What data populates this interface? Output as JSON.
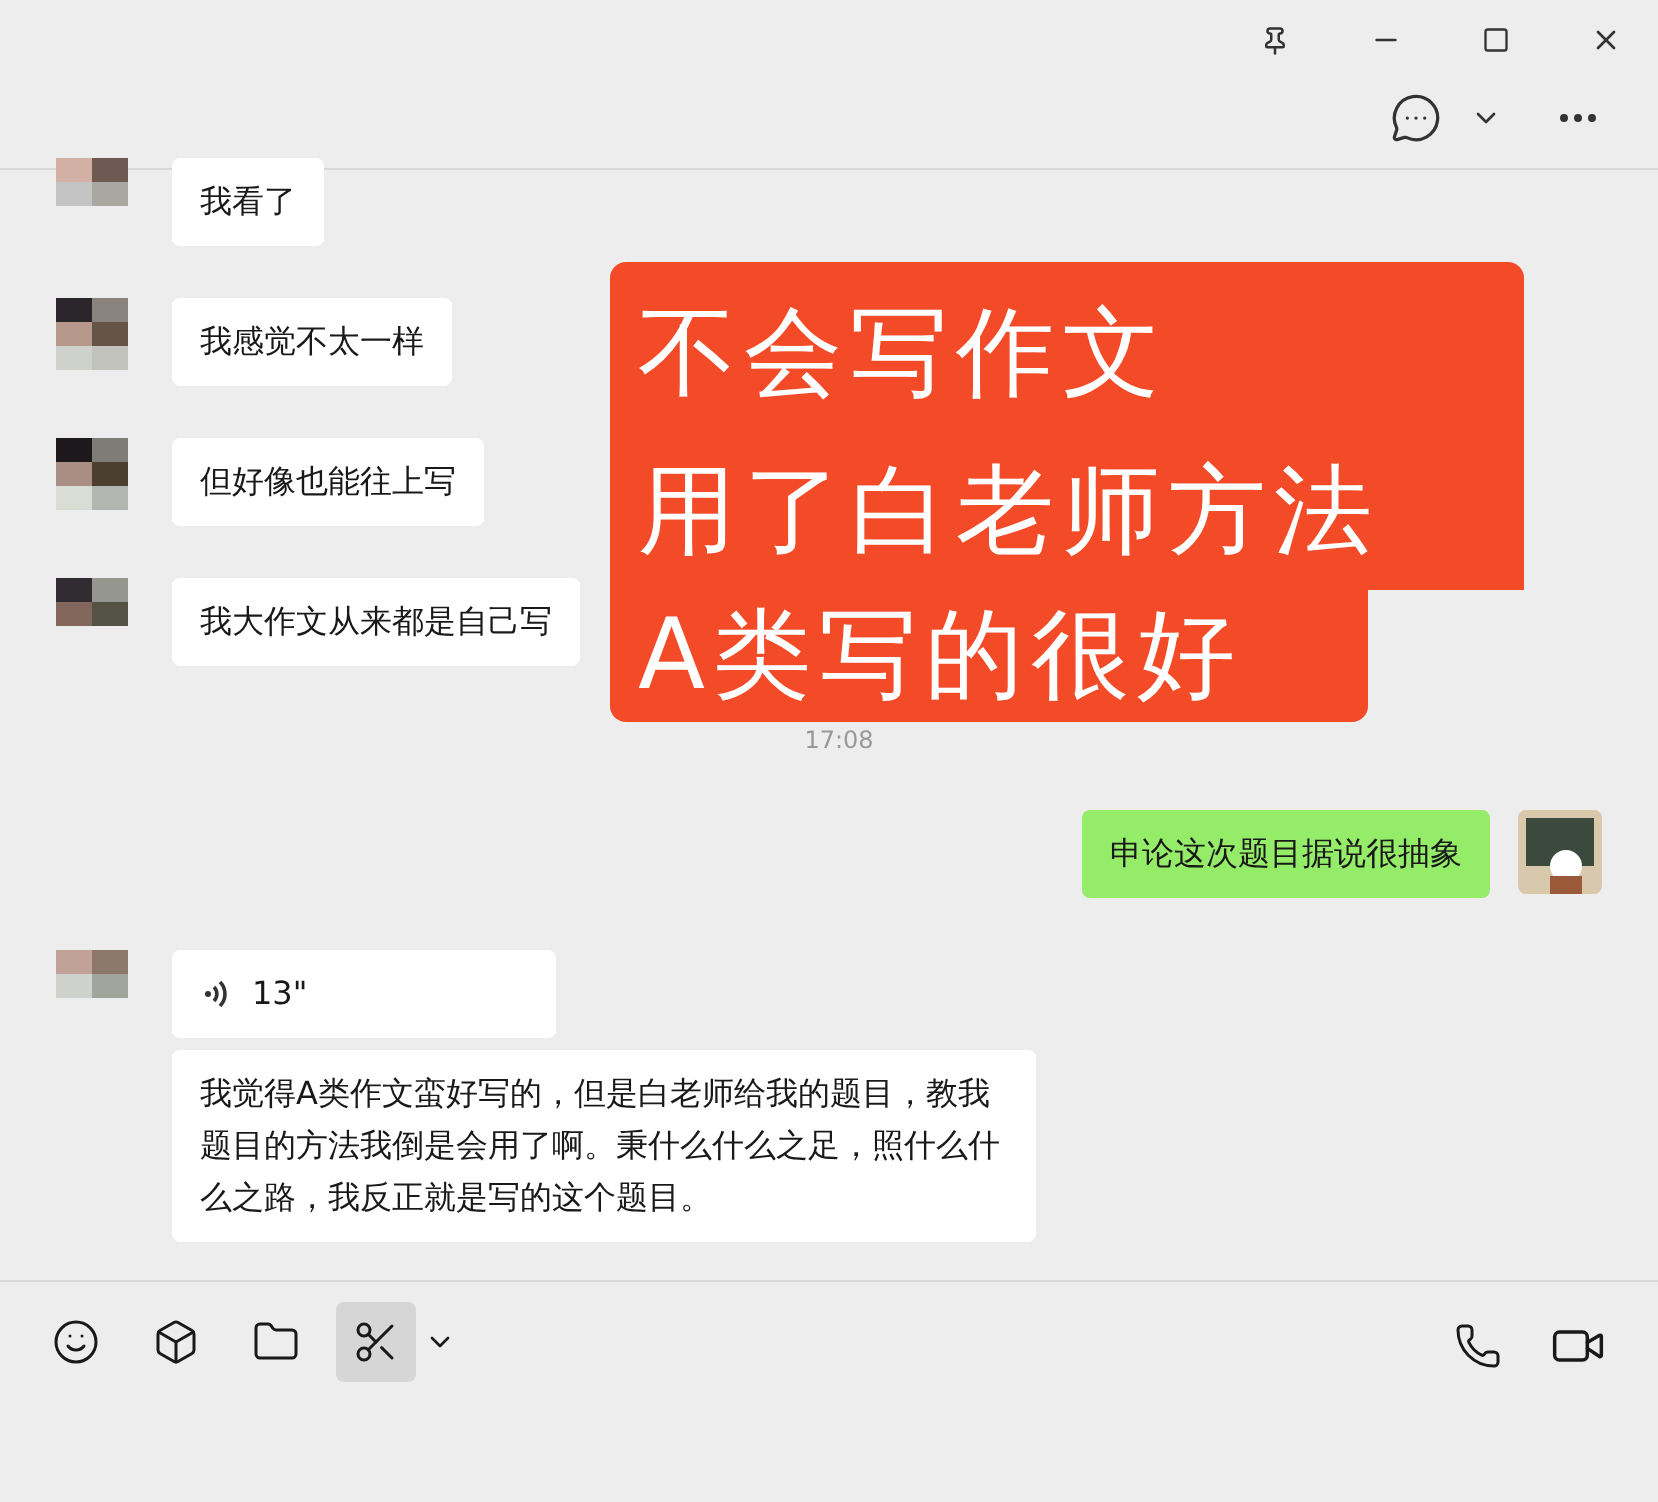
{
  "messages": [
    {
      "kind": "received",
      "text": "我看了"
    },
    {
      "kind": "received",
      "text": "我感觉不太一样"
    },
    {
      "kind": "received",
      "text": "但好像也能往上写"
    },
    {
      "kind": "received",
      "text": "我大作文从来都是自己写"
    },
    {
      "kind": "time",
      "text": "17:08"
    },
    {
      "kind": "sent",
      "text": "申论这次题目据说很抽象"
    },
    {
      "kind": "voice",
      "text": "13\""
    },
    {
      "kind": "followup",
      "text": "我觉得A类作文蛮好写的，但是白老师给我的题目，教我题目的方法我倒是会用了啊。秉什么什么之足，照什么什么之路，我反正就是写的这个题目。"
    }
  ],
  "overlay": {
    "lines": [
      "不会写作文",
      "用了白老师方法",
      "A类写的很好"
    ]
  },
  "toolbar": [
    {
      "kind": "emoji",
      "selected": false
    },
    {
      "kind": "box",
      "selected": false
    },
    {
      "kind": "folder",
      "selected": false
    },
    {
      "kind": "scissors",
      "selected": true
    }
  ]
}
